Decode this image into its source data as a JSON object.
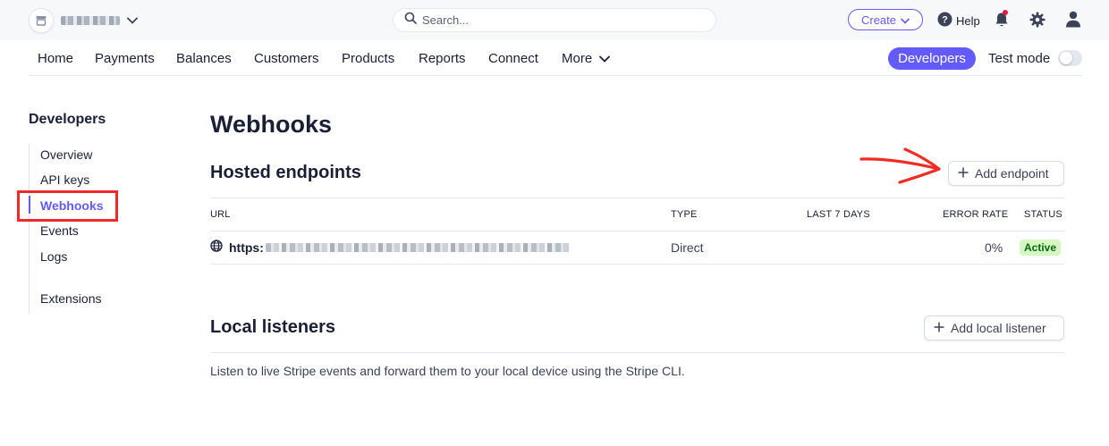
{
  "topbar": {
    "search_placeholder": "Search...",
    "create_label": "Create",
    "help_label": "Help"
  },
  "nav": {
    "items": [
      "Home",
      "Payments",
      "Balances",
      "Customers",
      "Products",
      "Reports",
      "Connect",
      "More"
    ],
    "developers_label": "Developers",
    "test_mode_label": "Test mode",
    "test_mode_on": false
  },
  "sidebar": {
    "title": "Developers",
    "items": [
      "Overview",
      "API keys",
      "Webhooks",
      "Events",
      "Logs",
      "Extensions"
    ],
    "active": "Webhooks"
  },
  "main": {
    "title": "Webhooks",
    "hosted": {
      "title": "Hosted endpoints",
      "add_label": "Add endpoint",
      "columns": [
        "URL",
        "TYPE",
        "LAST 7 DAYS",
        "ERROR RATE",
        "STATUS"
      ],
      "rows": [
        {
          "url": "https:",
          "type": "Direct",
          "last7": "",
          "error_rate": "0%",
          "status": "Active"
        }
      ]
    },
    "local": {
      "title": "Local listeners",
      "add_label": "Add local listener",
      "description": "Listen to live Stripe events and forward them to your local device using the Stripe CLI."
    }
  },
  "colors": {
    "accent": "#635bff",
    "annotation": "#ed2a2a",
    "status_bg": "#d7f7c2",
    "status_text": "#05690d"
  }
}
